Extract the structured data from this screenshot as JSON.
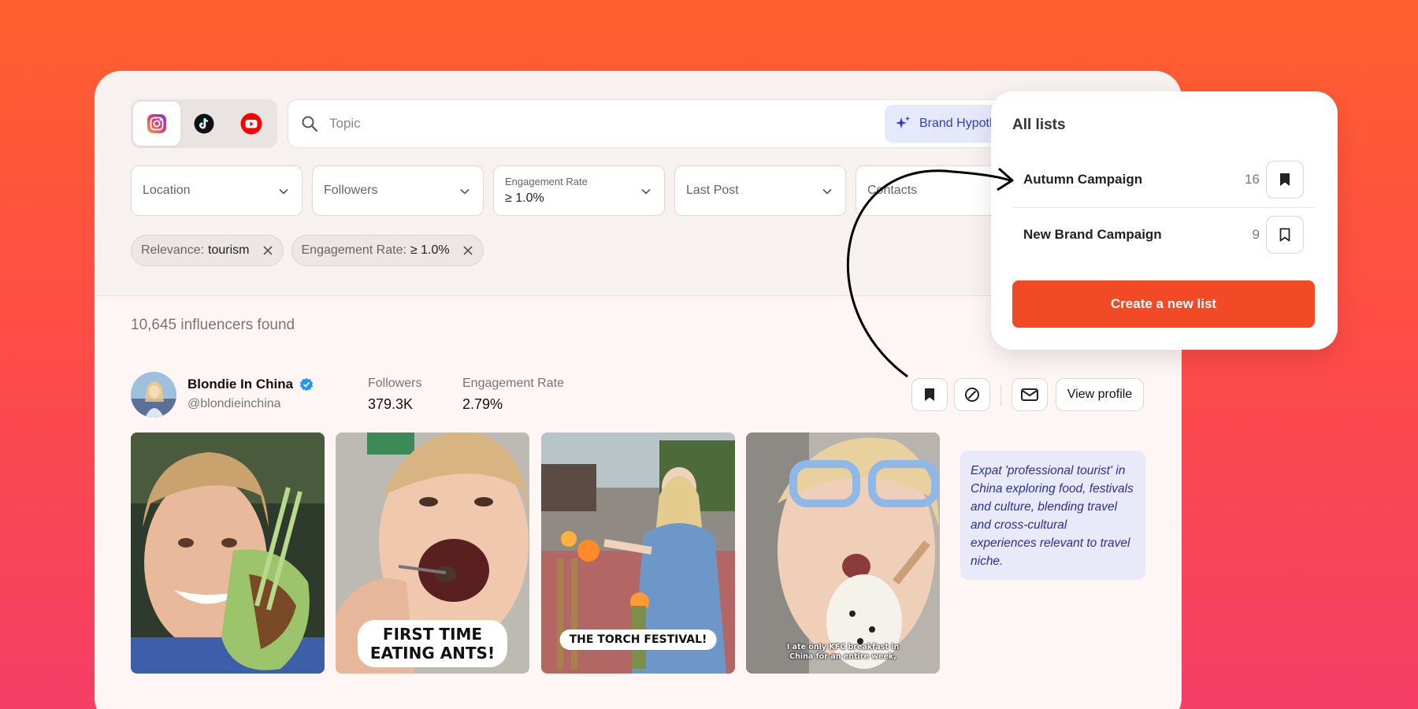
{
  "search": {
    "placeholder": "Topic",
    "brand_button": "Brand Hypothesis"
  },
  "filters": {
    "location": "Location",
    "followers": "Followers",
    "engagement_label": "Engagement Rate",
    "engagement_value": "≥ 1.0%",
    "last_post": "Last Post",
    "contacts": "Contacts"
  },
  "chips": [
    {
      "label": "Relevance:",
      "value": "tourism"
    },
    {
      "label": "Engagement Rate:",
      "value": "≥ 1.0%"
    }
  ],
  "results": {
    "found_text": "10,645 influencers found"
  },
  "influencer": {
    "name": "Blondie In China",
    "handle": "@blondieinchina",
    "followers_label": "Followers",
    "followers_value": "379.3K",
    "engagement_label": "Engagement Rate",
    "engagement_value": "2.79%",
    "view_profile": "View profile",
    "bio": "Expat 'professional tourist' in China exploring food, festivals and culture, blending travel and cross-cultural experiences relevant to travel niche.",
    "thumbnails": [
      {
        "caption": ""
      },
      {
        "caption_line1": "FIRST TIME",
        "caption_line2": "EATING ANTS!"
      },
      {
        "caption": "THE TORCH FESTIVAL!"
      },
      {
        "caption_line1": "I ate only KFC breakfast in",
        "caption_line2": "China for an entire week,"
      }
    ]
  },
  "lists_panel": {
    "title": "All lists",
    "lists": [
      {
        "name": "Autumn Campaign",
        "count": "16",
        "saved": true
      },
      {
        "name": "New Brand Campaign",
        "count": "9",
        "saved": false
      }
    ],
    "create_button": "Create a new list"
  },
  "colors": {
    "accent": "#f24a27",
    "brand_button_bg": "#e6e9fb",
    "brand_button_text": "#2f3ec9",
    "verified": "#2196f3"
  },
  "icons": [
    "instagram-icon",
    "tiktok-icon",
    "youtube-icon",
    "search-icon",
    "sparkle-icon",
    "chevron-down-icon",
    "close-icon",
    "verified-icon",
    "bookmark-icon",
    "block-icon",
    "mail-icon"
  ]
}
